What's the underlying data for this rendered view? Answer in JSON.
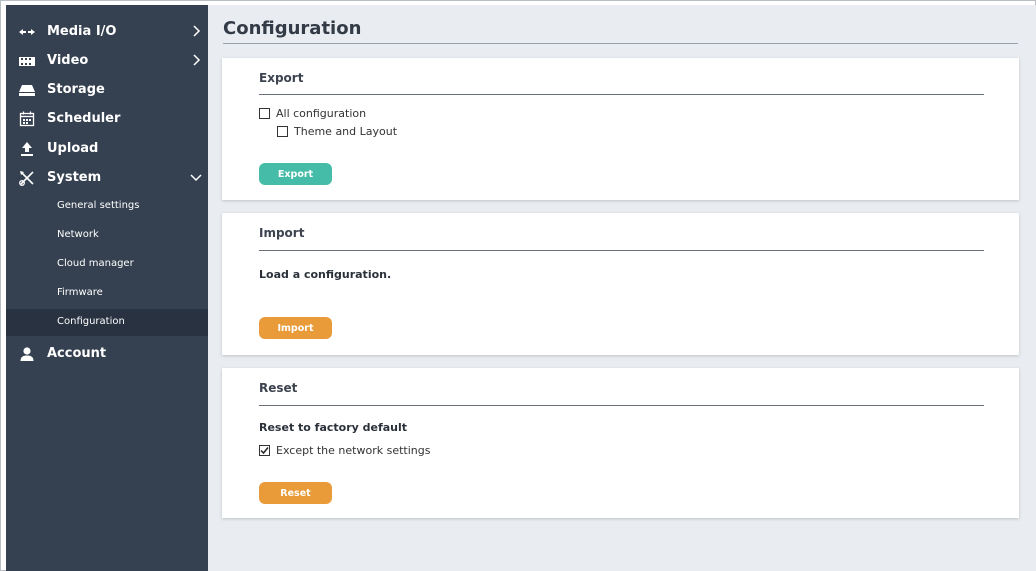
{
  "sidebar": {
    "items": [
      {
        "label": "Media I/O",
        "icon": "media-io-icon"
      },
      {
        "label": "Video",
        "icon": "video-icon"
      },
      {
        "label": "Storage",
        "icon": "storage-icon"
      },
      {
        "label": "Scheduler",
        "icon": "calendar-icon"
      },
      {
        "label": "Upload",
        "icon": "upload-icon"
      },
      {
        "label": "System",
        "icon": "tools-icon"
      },
      {
        "label": "Account",
        "icon": "user-icon"
      }
    ],
    "system_subitems": [
      {
        "label": "General settings"
      },
      {
        "label": "Network"
      },
      {
        "label": "Cloud manager"
      },
      {
        "label": "Firmware"
      },
      {
        "label": "Configuration",
        "active": true
      }
    ]
  },
  "page": {
    "title": "Configuration"
  },
  "export": {
    "title": "Export",
    "all_config_label": "All configuration",
    "all_config_checked": false,
    "theme_layout_label": "Theme and Layout",
    "theme_layout_checked": false,
    "button_label": "Export"
  },
  "import": {
    "title": "Import",
    "description": "Load a configuration.",
    "button_label": "Import"
  },
  "reset": {
    "title": "Reset",
    "description": "Reset to factory default",
    "except_network_label": "Except the network settings",
    "except_network_checked": true,
    "button_label": "Reset"
  },
  "colors": {
    "sidebar_bg": "#354050",
    "sidebar_active_bg": "#283240",
    "main_bg": "#e9edf1",
    "export_button": "#45bca8",
    "import_button": "#e99b3a",
    "reset_button": "#e99b3a"
  }
}
